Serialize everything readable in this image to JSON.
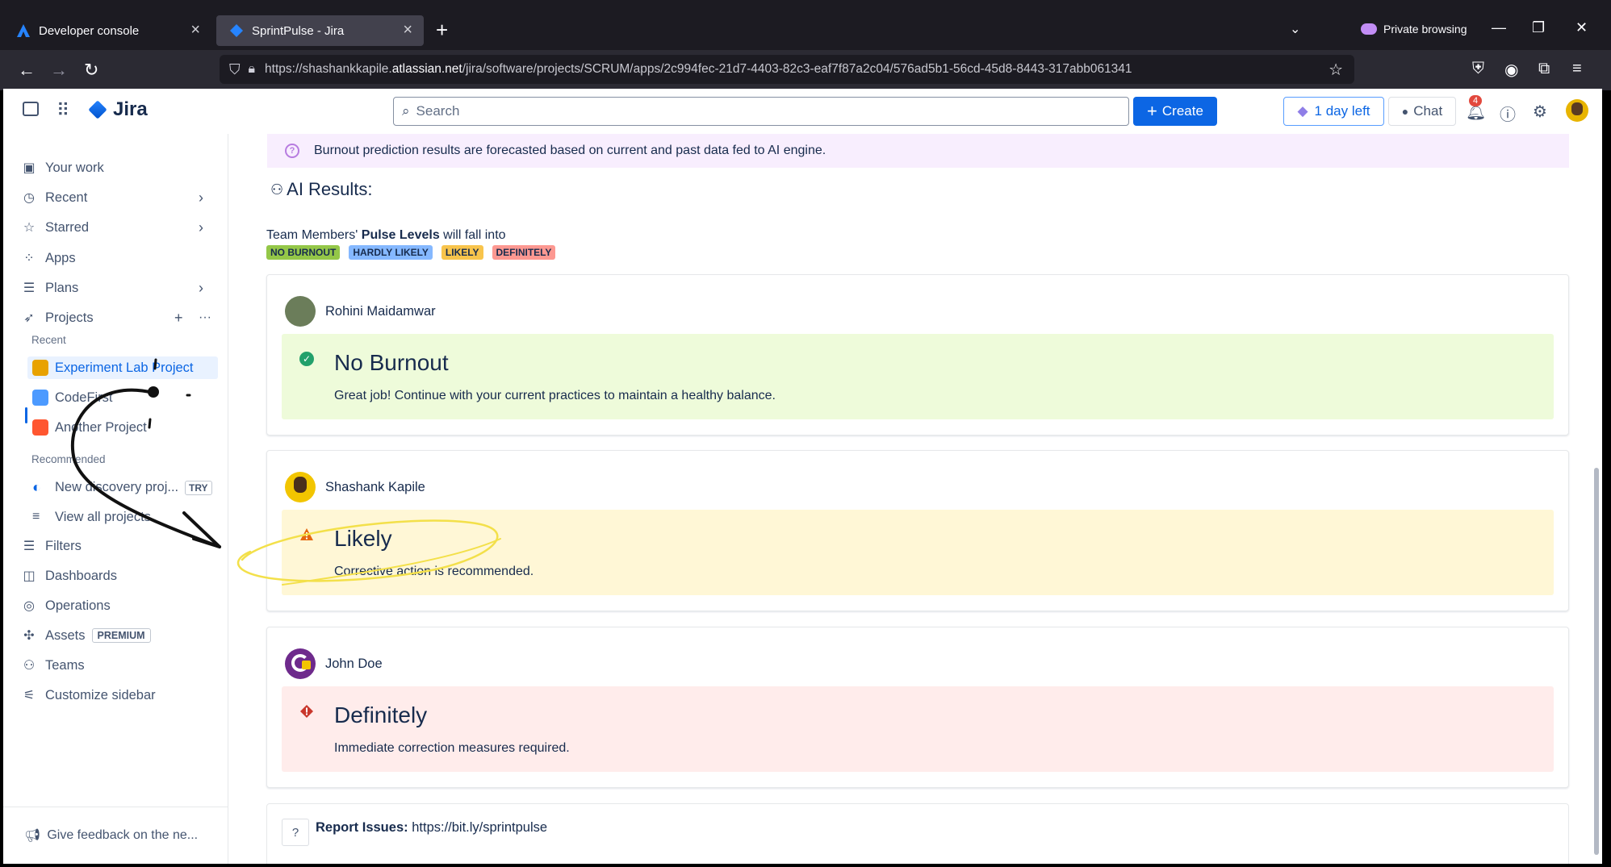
{
  "browser": {
    "tabs": [
      {
        "title": "Developer console",
        "active": false
      },
      {
        "title": "SprintPulse - Jira",
        "active": true
      }
    ],
    "private_label": "Private browsing",
    "url_prefix": "https://shashankkapile.",
    "url_host": "atlassian.net",
    "url_path": "/jira/software/projects/SCRUM/apps/2c994fec-21d7-4403-82c3-eaf7f87a2c04/576ad5b1-56cd-45d8-8443-317abb061341"
  },
  "topbar": {
    "product_name": "Jira",
    "search_placeholder": "Search",
    "create_label": "Create",
    "trial_label": "1 day left",
    "chat_label": "Chat",
    "notification_count": "4"
  },
  "sidebar": {
    "items": [
      {
        "label": "Your work",
        "icon": "your-work-icon"
      },
      {
        "label": "Recent",
        "icon": "clock-icon"
      },
      {
        "label": "Starred",
        "icon": "star-icon"
      },
      {
        "label": "Apps",
        "icon": "apps-icon"
      },
      {
        "label": "Plans",
        "icon": "plans-icon"
      },
      {
        "label": "Projects",
        "icon": "rocket-icon"
      }
    ],
    "recent_heading": "Recent",
    "recent_projects": [
      {
        "label": "Experiment Lab Project",
        "color": "#e8a200"
      },
      {
        "label": "CodeFirst",
        "color": "#4c9aff"
      },
      {
        "label": "Another Project",
        "color": "#ff5630"
      }
    ],
    "recommended_heading": "Recommended",
    "recommended_item": "New discovery proj...",
    "try_badge": "TRY",
    "view_all": "View all projects",
    "bottom_items": [
      {
        "label": "Filters",
        "icon": "filter-icon"
      },
      {
        "label": "Dashboards",
        "icon": "dashboard-icon"
      },
      {
        "label": "Operations",
        "icon": "operations-icon"
      },
      {
        "label": "Assets",
        "icon": "assets-icon"
      },
      {
        "label": "Teams",
        "icon": "teams-icon"
      },
      {
        "label": "Customize sidebar",
        "icon": "customize-icon"
      }
    ],
    "premium_badge": "PREMIUM",
    "feedback": "Give feedback on the ne..."
  },
  "main": {
    "banner": "Burnout prediction results are forecasted based on current and past data fed to AI engine.",
    "ai_heading": "AI Results:",
    "pulse_intro_before": "Team Members'",
    "pulse_intro_bold": "Pulse Levels",
    "pulse_intro_after": "will fall into",
    "legend": [
      {
        "label": "NO BURNOUT",
        "color": "#94c748"
      },
      {
        "label": "HARDLY LIKELY",
        "color": "#85b8ff"
      },
      {
        "label": "LIKELY",
        "color": "#f8c44c"
      },
      {
        "label": "DEFINITELY",
        "color": "#fd9891"
      }
    ],
    "results": [
      {
        "name": "Rohini Maidamwar",
        "title": "No Burnout",
        "description": "Great job! Continue with your current practices to maintain a healthy balance.",
        "bg": "#eefbda",
        "icon": "check-circle-icon",
        "icon_color": "#22a06b"
      },
      {
        "name": "Shashank Kapile",
        "title": "Likely",
        "description": "Corrective action is recommended.",
        "bg": "#fff7d6",
        "icon": "warning-icon",
        "icon_color": "#e56910"
      },
      {
        "name": "John Doe",
        "title": "Definitely",
        "description": "Immediate correction measures required.",
        "bg": "#ffeceb",
        "icon": "error-icon",
        "icon_color": "#c9372c"
      }
    ],
    "report_label": "Report Issues:",
    "report_link": "https://bit.ly/sprintpulse"
  }
}
